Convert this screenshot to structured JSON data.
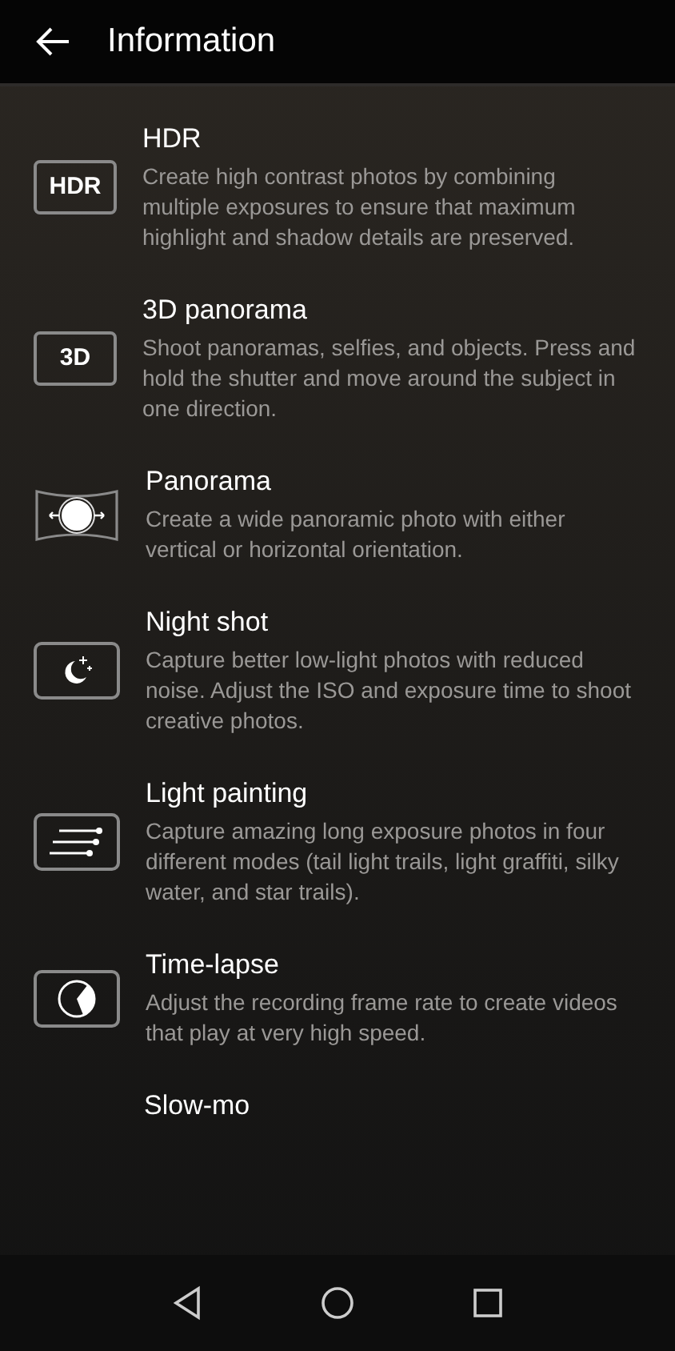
{
  "header": {
    "title": "Information"
  },
  "modes": [
    {
      "kind": "text_badge",
      "badge": "HDR",
      "title": "HDR",
      "description": "Create high contrast photos by combining multiple exposures to ensure that maximum highlight and shadow details are preserved."
    },
    {
      "kind": "text_badge",
      "badge": "3D",
      "title": "3D panorama",
      "description": "Shoot panoramas, selfies, and objects. Press and hold the shutter and move around the subject in one direction."
    },
    {
      "kind": "panorama",
      "title": "Panorama",
      "description": "Create a wide panoramic photo with either vertical or horizontal orientation."
    },
    {
      "kind": "night",
      "title": "Night shot",
      "description": "Capture better low-light photos with reduced noise. Adjust the ISO and exposure time to shoot creative photos."
    },
    {
      "kind": "light_trails",
      "title": "Light painting",
      "description": "Capture amazing long exposure photos in four different modes (tail light trails, light graffiti, silky water, and star trails)."
    },
    {
      "kind": "timelapse",
      "title": "Time-lapse",
      "description": "Adjust the recording frame rate to create videos that play at very high speed."
    },
    {
      "kind": "cut",
      "title": "Slow-mo"
    }
  ]
}
